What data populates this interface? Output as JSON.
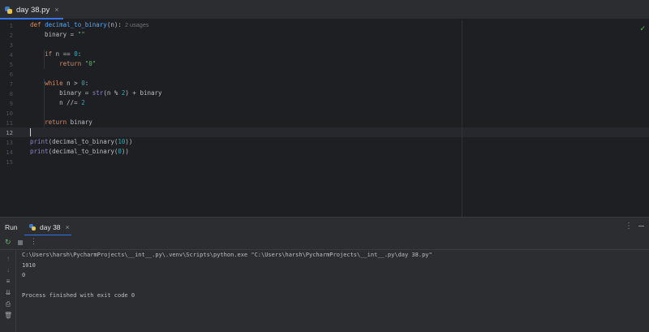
{
  "editor_tab": {
    "title": "day 38.py",
    "close": "×"
  },
  "code_lines": [
    {
      "num": "1",
      "parts": [
        [
          "def ",
          "kw"
        ],
        [
          "decimal_to_binary",
          "fn"
        ],
        [
          "(n):",
          ""
        ],
        [
          "  2 usages",
          "hint"
        ]
      ]
    },
    {
      "num": "2",
      "parts": [
        [
          "    binary = ",
          ""
        ],
        [
          "\"\"",
          "str"
        ]
      ]
    },
    {
      "num": "3",
      "parts": []
    },
    {
      "num": "4",
      "parts": [
        [
          "    ",
          ""
        ],
        [
          "if ",
          "kw"
        ],
        [
          "n == ",
          ""
        ],
        [
          "0",
          "num"
        ],
        [
          ":",
          ""
        ]
      ]
    },
    {
      "num": "5",
      "parts": [
        [
          "        ",
          ""
        ],
        [
          "return ",
          "kw"
        ],
        [
          "\"0\"",
          "str"
        ]
      ]
    },
    {
      "num": "6",
      "parts": []
    },
    {
      "num": "7",
      "parts": [
        [
          "    ",
          ""
        ],
        [
          "while ",
          "kw"
        ],
        [
          "n > ",
          ""
        ],
        [
          "0",
          "num"
        ],
        [
          ":",
          ""
        ]
      ]
    },
    {
      "num": "8",
      "parts": [
        [
          "        binary = ",
          ""
        ],
        [
          "str",
          "bi"
        ],
        [
          "(n % ",
          ""
        ],
        [
          "2",
          "num"
        ],
        [
          ") + binary",
          ""
        ]
      ]
    },
    {
      "num": "9",
      "parts": [
        [
          "        n //= ",
          ""
        ],
        [
          "2",
          "num"
        ]
      ]
    },
    {
      "num": "10",
      "parts": []
    },
    {
      "num": "11",
      "parts": [
        [
          "    ",
          ""
        ],
        [
          "return ",
          "kw"
        ],
        [
          "binary",
          ""
        ]
      ]
    },
    {
      "num": "12",
      "parts": []
    },
    {
      "num": "13",
      "parts": [
        [
          "print",
          "bi"
        ],
        [
          "(decimal_to_binary(",
          ""
        ],
        [
          "10",
          "num"
        ],
        [
          "))",
          ""
        ]
      ]
    },
    {
      "num": "14",
      "parts": [
        [
          "print",
          "bi"
        ],
        [
          "(decimal_to_binary(",
          ""
        ],
        [
          "0",
          "num"
        ],
        [
          "))",
          ""
        ]
      ]
    },
    {
      "num": "15",
      "parts": []
    }
  ],
  "run_panel": {
    "title": "Run",
    "tab_label": "day 38",
    "tab_close": "×",
    "more": "⋮",
    "output": [
      "C:\\Users\\harsh\\PycharmProjects\\__int__.py\\.venv\\Scripts\\python.exe \"C:\\Users\\harsh\\PycharmProjects\\__int__.py\\day 38.py\"",
      "1010",
      "0",
      "",
      "Process finished with exit code 0"
    ]
  },
  "colors": {
    "background": "#1e1f22",
    "panel": "#2b2d30",
    "accent": "#3574f0",
    "keyword": "#cf8e6d",
    "function": "#56a8f5",
    "string": "#6aab73",
    "number": "#2aacb8",
    "builtin": "#8888c6"
  },
  "icons": [
    "python-file-icon",
    "check-icon",
    "rerun-icon",
    "stop-icon",
    "more-icon",
    "up-arrow-icon",
    "down-arrow-icon",
    "soft-wrap-icon",
    "scroll-to-end-icon",
    "print-icon",
    "trash-icon"
  ]
}
